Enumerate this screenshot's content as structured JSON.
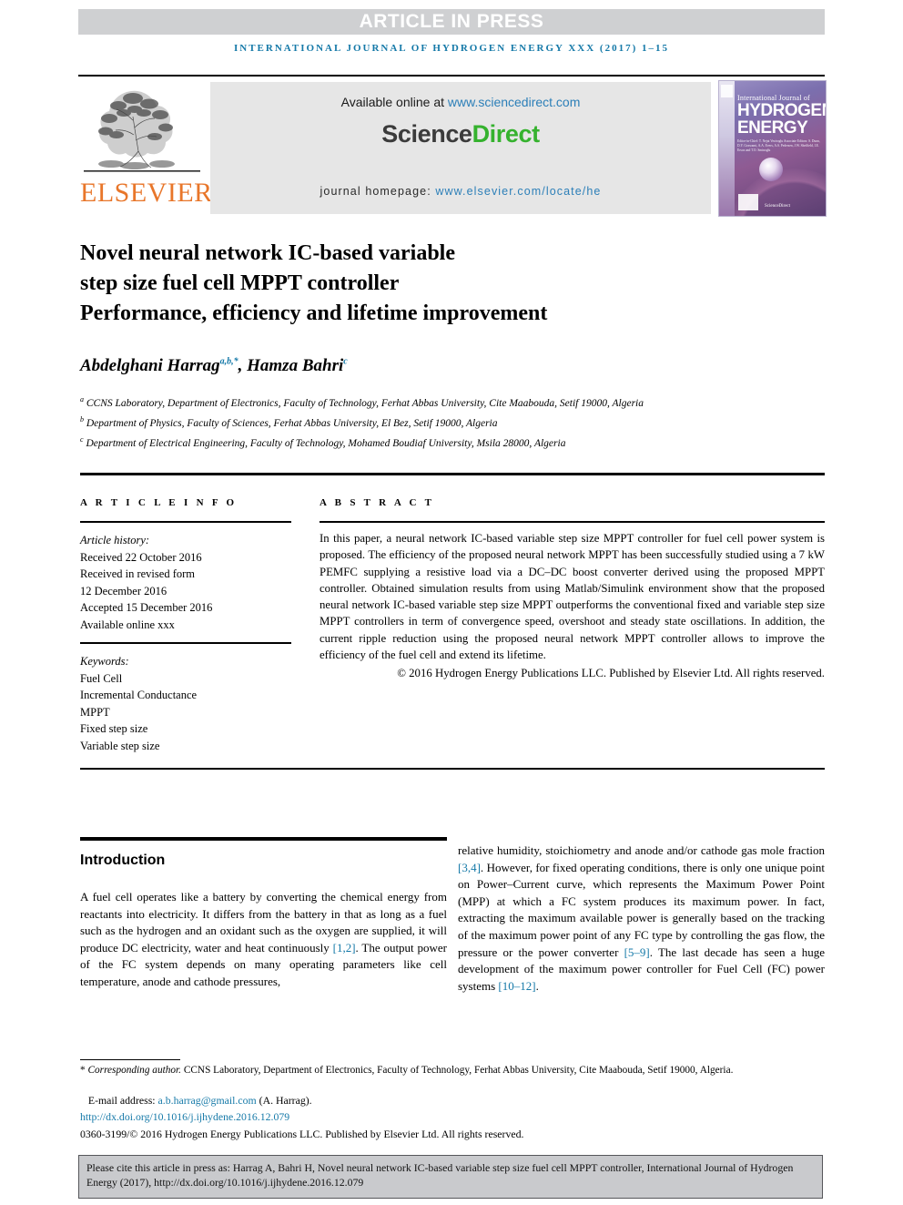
{
  "banner": {
    "text": "ARTICLE IN PRESS"
  },
  "running_head": {
    "text": "INTERNATIONAL JOURNAL OF HYDROGEN ENERGY XXX (2017) 1–15"
  },
  "masthead": {
    "publisher": "ELSEVIER",
    "available_prefix": "Available online at ",
    "available_url": "www.sciencedirect.com",
    "logo_part1": "Science",
    "logo_part2": "Direct",
    "homepage_prefix": "journal homepage: ",
    "homepage_url": "www.elsevier.com/locate/he"
  },
  "cover": {
    "line_small": "International Journal of",
    "line_big1": "HYDROGEN",
    "line_big2": "ENERGY",
    "editors": "Editor-in-Chief: T. Nejat Veziroglu    Associate Editors: S. Dunn, D.Y. Goswami, A.A. Evers, A.S. Pedersen, J.W. Sheffield, I.E. Ersoz and T.O. Sminoglu",
    "sciencedirect": "ScienceDirect"
  },
  "title": {
    "line1": "Novel neural network IC-based variable",
    "line2": "step size fuel cell MPPT controller",
    "line3": "Performance, efficiency and lifetime improvement"
  },
  "authors": {
    "name1": "Abdelghani Harrag",
    "sup1": "a,b,*",
    "separator": ", ",
    "name2": "Hamza Bahri",
    "sup2": "c",
    "affiliations": [
      {
        "marker": "a",
        "text": "CCNS Laboratory, Department of Electronics, Faculty of Technology, Ferhat Abbas University, Cite Maabouda, Setif 19000, Algeria"
      },
      {
        "marker": "b",
        "text": "Department of Physics, Faculty of Sciences, Ferhat Abbas University, El Bez, Setif 19000, Algeria"
      },
      {
        "marker": "c",
        "text": "Department of Electrical Engineering, Faculty of Technology, Mohamed Boudiaf University, Msila 28000, Algeria"
      }
    ]
  },
  "article_info": {
    "heading": "A R T I C L E   I N F O",
    "history_label": "Article history:",
    "history": [
      "Received 22 October 2016",
      "Received in revised form",
      "12 December 2016",
      "Accepted 15 December 2016",
      "Available online xxx"
    ],
    "keywords_label": "Keywords:",
    "keywords": [
      "Fuel Cell",
      "Incremental Conductance",
      "MPPT",
      "Fixed step size",
      "Variable step size"
    ]
  },
  "abstract": {
    "heading": "A B S T R A C T",
    "text": "In this paper, a neural network IC-based variable step size MPPT controller for fuel cell power system is proposed. The efficiency of the proposed neural network MPPT has been successfully studied using a 7 kW PEMFC supplying a resistive load via a DC–DC boost converter derived using the proposed MPPT controller. Obtained simulation results from using Matlab/Simulink environment show that the proposed neural network IC-based variable step size MPPT outperforms the conventional fixed and variable step size MPPT controllers in term of convergence speed, overshoot and steady state oscillations. In addition, the current ripple reduction using the proposed neural network MPPT controller allows to improve the efficiency of the fuel cell and extend its lifetime.",
    "copyright": "© 2016 Hydrogen Energy Publications LLC. Published by Elsevier Ltd. All rights reserved."
  },
  "body": {
    "section_title": "Introduction",
    "left_paragraph_a": "A fuel cell operates like a battery by converting the chemical energy from reactants into electricity. It differs from the battery in that as long as a fuel such as the hydrogen and an oxidant such as the oxygen are supplied, it will produce DC electricity, water and heat continuously ",
    "left_ref_1": "[1,2]",
    "left_paragraph_b": ". The output power of the FC system depends on many operating parameters like cell temperature, anode and cathode pressures,",
    "right_paragraph_a": "relative humidity, stoichiometry and anode and/or cathode gas mole fraction ",
    "right_ref_1": "[3,4]",
    "right_paragraph_b": ". However, for fixed operating conditions, there is only one unique point on Power–Current curve, which represents the Maximum Power Point (MPP) at which a FC system produces its maximum power. In fact, extracting the maximum available power is generally based on the tracking of the maximum power point of any FC type by controlling the gas flow, the pressure or the power converter ",
    "right_ref_2": "[5–9]",
    "right_paragraph_c": ". The last decade has seen a huge development of the maximum power controller for Fuel Cell (FC) power systems ",
    "right_ref_3": "[10–12]",
    "right_paragraph_d": "."
  },
  "footer": {
    "corresponding_marker": "*",
    "corresponding_label": "Corresponding author.",
    "corresponding_text": " CCNS Laboratory, Department of Electronics, Faculty of Technology, Ferhat Abbas University, Cite Maabouda, Setif 19000, Algeria.",
    "email_label": "E-mail address: ",
    "email": "a.b.harrag@gmail.com",
    "email_suffix": " (A. Harrag).",
    "doi": "http://dx.doi.org/10.1016/j.ijhydene.2016.12.079",
    "issn_line": "0360-3199/© 2016 Hydrogen Energy Publications LLC. Published by Elsevier Ltd. All rights reserved."
  },
  "cite_box": {
    "text": "Please cite this article in press as: Harrag A, Bahri H, Novel neural network IC-based variable step size fuel cell MPPT controller, International Journal of Hydrogen Energy (2017), http://dx.doi.org/10.1016/j.ijhydene.2016.12.079"
  },
  "colors": {
    "link_blue": "#1579a8",
    "elsevier_orange": "#e8762a",
    "sciencedirect_green": "#35b22e",
    "banner_gray": "#cfd0d2",
    "box_gray": "#e6e6e6",
    "cite_gray": "#c9cacd"
  }
}
